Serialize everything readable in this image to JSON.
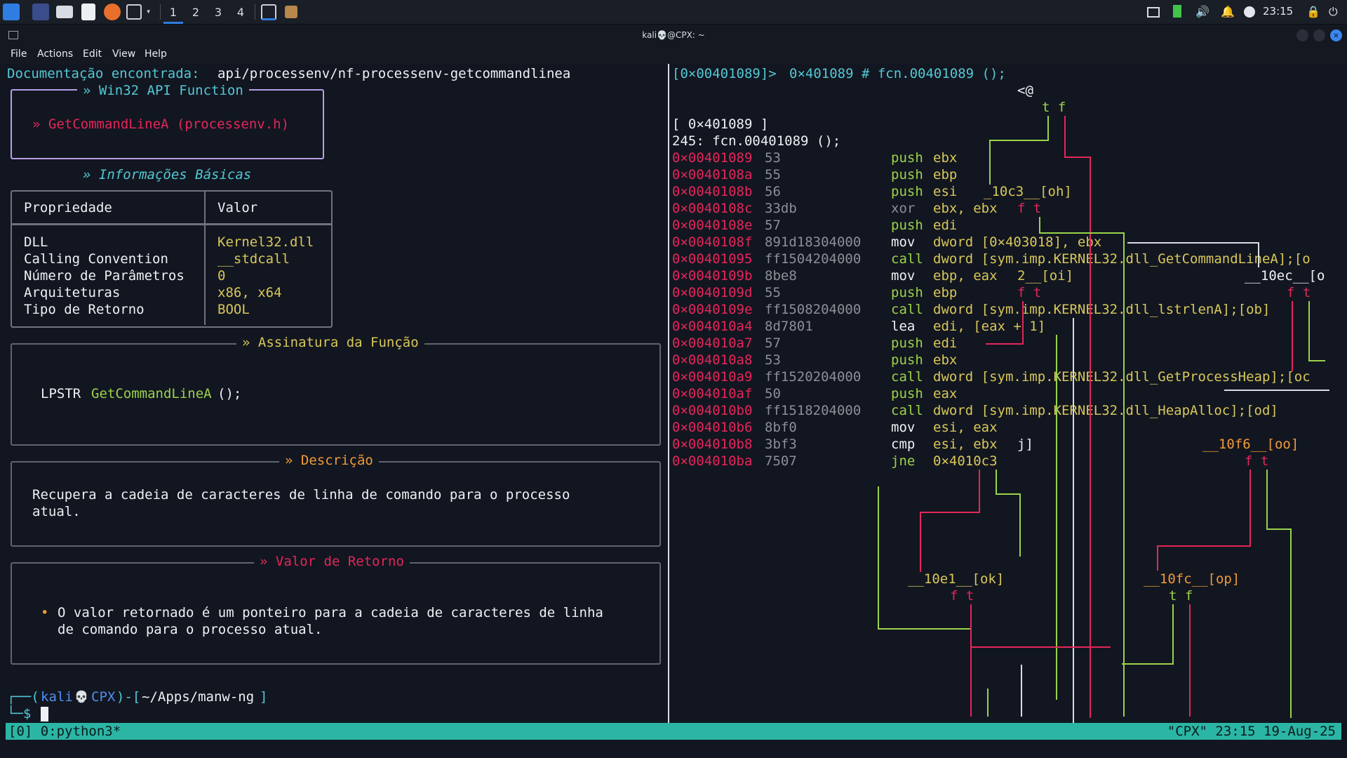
{
  "taskbar": {
    "workspaces": [
      "1",
      "2",
      "3",
      "4"
    ],
    "clock": "23:15",
    "icons": [
      "kali-menu-icon",
      "desktop-icon",
      "file-manager-icon",
      "text-editor-icon",
      "firefox-icon",
      "terminal-icon",
      "chevron-down-icon",
      "terminal-active-icon",
      "tool-icon"
    ],
    "tray_icons": [
      "display-icon",
      "battery-icon",
      "volume-icon",
      "bell-icon",
      "clock-icon",
      "lock-icon",
      "power-icon"
    ]
  },
  "window": {
    "title": "kali💀@CPX: ~"
  },
  "menu": [
    "File",
    "Actions",
    "Edit",
    "View",
    "Help"
  ],
  "left": {
    "doc_label": "Documentação encontrada:",
    "doc_path": "api/processenv/nf-processenv-getcommandlinea",
    "win32_title": "» Win32 API Function",
    "func_title": "» GetCommandLineA (processenv.h)",
    "info_title": "» Informações Básicas",
    "table": {
      "headers": [
        "Propriedade",
        "Valor"
      ],
      "rows": [
        [
          "DLL",
          "Kernel32.dll"
        ],
        [
          "Calling Convention",
          "__stdcall"
        ],
        [
          "Número de Parâmetros",
          "0"
        ],
        [
          "Arquiteturas",
          "x86, x64"
        ],
        [
          "Tipo de Retorno",
          "BOOL"
        ]
      ]
    },
    "signature_title": "» Assinatura da Função",
    "signature_type": "LPSTR",
    "signature_name": "GetCommandLineA",
    "signature_rest": "();",
    "desc_title": "» Descrição",
    "desc_line1": "Recupera a cadeia de caracteres de linha de comando para o processo",
    "desc_line2": "atual.",
    "ret_title": "» Valor de Retorno",
    "ret_bullet": "•",
    "ret_line1": "O valor retornado é um ponteiro para a cadeia de caracteres de linha",
    "ret_line2": "de comando para o processo atual.",
    "prompt_prefix": "┌──(",
    "prompt_user": "kali",
    "prompt_skull": "💀",
    "prompt_host": "CPX",
    "prompt_mid": ")-[",
    "prompt_path": "~/Apps/manw-ng",
    "prompt_end": "]",
    "prompt_line2": "└─$"
  },
  "right": {
    "header_addr": "[0×00401089]>",
    "header_cmd": "0×401089 # fcn.00401089 ();",
    "at": "<@",
    "block_addr": "[ 0×401089 ]",
    "func_line": "245: fcn.00401089 ();",
    "asm": [
      {
        "addr": "0×00401089",
        "bytes": "53",
        "mn": "push",
        "op": "ebx"
      },
      {
        "addr": "0×0040108a",
        "bytes": "55",
        "mn": "push",
        "op": "ebp"
      },
      {
        "addr": "0×0040108b",
        "bytes": "56",
        "mn": "push",
        "op": "esi"
      },
      {
        "addr": "0×0040108c",
        "bytes": "33db",
        "mn": "xor",
        "op": "ebx, ebx"
      },
      {
        "addr": "0×0040108e",
        "bytes": "57",
        "mn": "push",
        "op": "edi"
      },
      {
        "addr": "0×0040108f",
        "bytes": "891d18304000",
        "mn": "mov",
        "op": "dword [0×403018], ebx"
      },
      {
        "addr": "0×00401095",
        "bytes": "ff1504204000",
        "mn": "call",
        "op": "dword [sym.imp.KERNEL32.dll_GetCommandLineA];[o"
      },
      {
        "addr": "0×0040109b",
        "bytes": "8be8",
        "mn": "mov",
        "op": "ebp, eax"
      },
      {
        "addr": "0×0040109d",
        "bytes": "55",
        "mn": "push",
        "op": "ebp"
      },
      {
        "addr": "0×0040109e",
        "bytes": "ff1508204000",
        "mn": "call",
        "op": "dword [sym.imp.KERNEL32.dll_lstrlenA];[ob]"
      },
      {
        "addr": "0×004010a4",
        "bytes": "8d7801",
        "mn": "lea",
        "op": "edi, [eax + 1]"
      },
      {
        "addr": "0×004010a7",
        "bytes": "57",
        "mn": "push",
        "op": "edi"
      },
      {
        "addr": "0×004010a8",
        "bytes": "53",
        "mn": "push",
        "op": "ebx"
      },
      {
        "addr": "0×004010a9",
        "bytes": "ff1520204000",
        "mn": "call",
        "op": "dword [sym.imp.KERNEL32.dll_GetProcessHeap];[oc"
      },
      {
        "addr": "0×004010af",
        "bytes": "50",
        "mn": "push",
        "op": "eax"
      },
      {
        "addr": "0×004010b0",
        "bytes": "ff1518204000",
        "mn": "call",
        "op": "dword [sym.imp.KERNEL32.dll_HeapAlloc];[od]"
      },
      {
        "addr": "0×004010b6",
        "bytes": "8bf0",
        "mn": "mov",
        "op": "esi, eax"
      },
      {
        "addr": "0×004010b8",
        "bytes": "3bf3",
        "mn": "cmp",
        "op": "esi, ebx"
      },
      {
        "addr": "0×004010ba",
        "bytes": "7507",
        "mn": "jne",
        "op": "0×4010c3"
      }
    ],
    "node_10c3": "_10c3__[oh]",
    "node_2": "2__[oi]",
    "node_j": "j]",
    "node_10ec": "__10ec__[o",
    "node_10f6": "__10f6__[oo]",
    "node_10e1": "__10e1__[ok]",
    "node_10fc": "__10fc__[op]",
    "tf_ft": "f t",
    "tf_tf": "t f",
    "tf_tf_top": "t f"
  },
  "status": {
    "left": "[0] 0:python3*",
    "right": "\"CPX\" 23:15 19-Aug-25"
  }
}
